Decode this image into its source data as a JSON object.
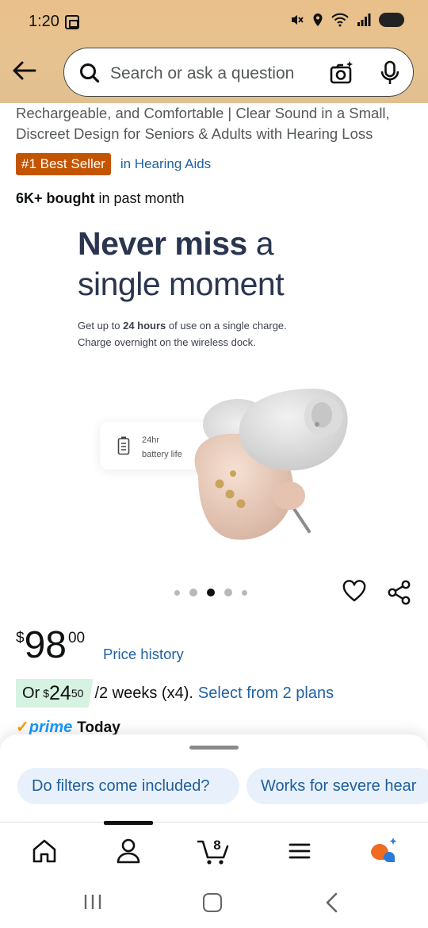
{
  "status_bar": {
    "time": "1:20",
    "icons": [
      "screenshot-icon",
      "mute-icon",
      "location-icon",
      "wifi-icon",
      "signal-icon",
      "battery-icon"
    ]
  },
  "header": {
    "search_placeholder": "Search or ask a question"
  },
  "product": {
    "title_lines": [
      "Rechargeable, and Comfortable | Clear Sound in a Small,",
      "Discreet Design for Seniors & Adults with Hearing Loss"
    ],
    "badge": "#1 Best Seller",
    "badge_category": "in Hearing Aids",
    "bought_bold": "6K+ bought",
    "bought_rest": " in past month"
  },
  "hero": {
    "headline_bold": "Never miss",
    "headline_rest": " a",
    "headline_line2": "single moment",
    "sub_pre": "Get up to ",
    "sub_bold": "24 hours",
    "sub_post": " of use on a single charge.",
    "sub_line2": "Charge overnight on the wireless dock.",
    "chip_line1": "24hr",
    "chip_line2": "battery life"
  },
  "carousel": {
    "count": 5,
    "active_index": 2
  },
  "price": {
    "symbol": "$",
    "whole": "98",
    "fraction": "00",
    "history_link": "Price history"
  },
  "installment": {
    "prefix": "Or ",
    "symbol": "$",
    "whole": "24",
    "fraction": "50",
    "terms": " /2 weeks (x4).",
    "link": "Select from 2 plans"
  },
  "prime": {
    "check": "✓",
    "label": "prime",
    "delivery": "Today"
  },
  "suggestions": [
    "Do filters come included?",
    "Works for severe hear"
  ],
  "bottom_nav": {
    "cart_count": "8",
    "active": "account"
  },
  "colors": {
    "header_bg": "#e6c290",
    "badge_bg": "#c45500",
    "link": "#2162a1",
    "plan_bg": "#d6f2e1",
    "prime_blue": "#1399ff",
    "hero_text": "#2a3550"
  }
}
